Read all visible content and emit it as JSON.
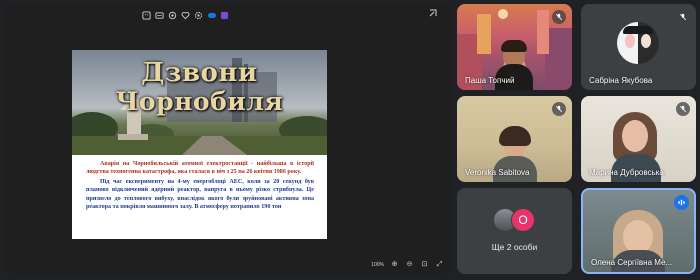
{
  "presentation": {
    "toolbar_icons": [
      "emoji-icon",
      "captions-icon",
      "hand-icon",
      "heart-icon",
      "settings-icon",
      "cloud-icon",
      "purple-app-icon"
    ],
    "slide": {
      "title_line1": "Дзвони",
      "title_line2": "Чорнобиля",
      "paragraph1": "Аварія на Чорнобильській атомної електростанції - найбільша в історії людства техногенна катастрофа, яка сталася в ніч з 25 на 26 квітня 1986 року.",
      "paragraph2": "Під час експерименту на 4-му енергоблоці АЕС, коли за 20 секунд був планово відключений ядерний реактор, напруга в ньому різко стрибнула. Це призвело до теплового вибуху, внаслідок якого були зруйновані активна зона реактора та покрівля машинного залу. В атмосферу потрапило 190 тон"
    },
    "zoom": "100%"
  },
  "participants": [
    {
      "name": "Паша Топчий",
      "muted": true
    },
    {
      "name": "Сабріна Якубова",
      "muted": true
    },
    {
      "name": "Veronika Sabitova",
      "muted": true
    },
    {
      "name": "Марина Дубровська",
      "muted": true
    },
    {
      "name": "Олена Сергіївна Ме...",
      "muted": false
    }
  ],
  "more": {
    "label": "Ще 2 особи",
    "avatar_letter": "O",
    "avatar_color": "#e8336d"
  },
  "colors": {
    "background": "#202124",
    "active_speaker": "#1a73e8",
    "para1": "#a83220",
    "para2": "#1f3a93"
  }
}
